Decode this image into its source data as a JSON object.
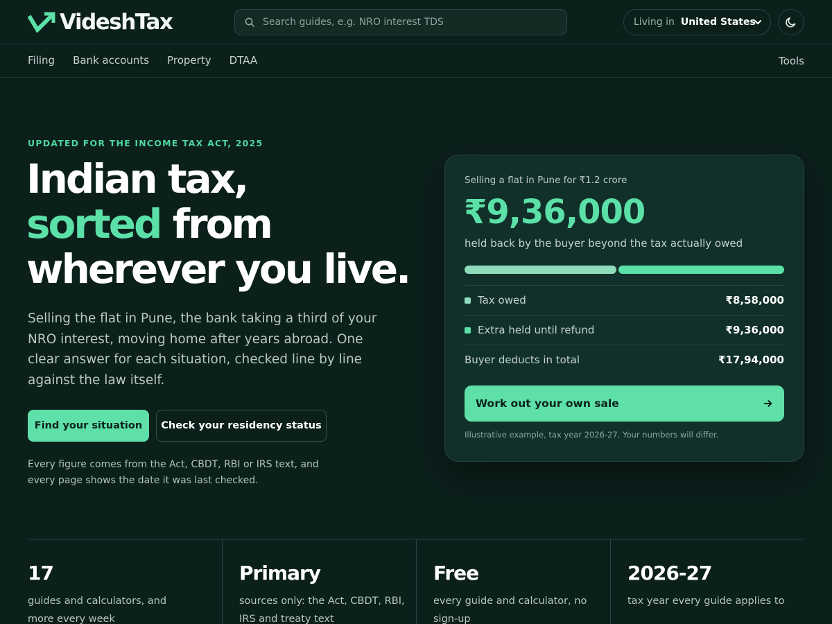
{
  "brand": {
    "name": "VideshTax",
    "accent": "#5be0a7",
    "background": "#0b1f1b"
  },
  "header": {
    "search": {
      "placeholder": "Search guides, e.g. NRO interest TDS",
      "value": "",
      "icon": "search-icon"
    },
    "region": {
      "label": "Living in",
      "selected": "United States",
      "icon": "chevron-down-icon"
    },
    "theme_toggle": {
      "icon": "moon-icon"
    }
  },
  "nav": {
    "items": [
      {
        "label": "Filing"
      },
      {
        "label": "Bank accounts"
      },
      {
        "label": "Property"
      },
      {
        "label": "DTAA"
      }
    ],
    "right_item": {
      "label": "Tools"
    }
  },
  "hero": {
    "eyebrow": "UPDATED FOR THE INCOME TAX ACT, 2025",
    "headline": {
      "line1": "Indian tax,",
      "accent": "sorted",
      "line2_rest": " from",
      "line3": "wherever you live."
    },
    "lede": "Selling the flat in Pune, the bank taking a third of your NRO interest, moving home after years abroad. One clear answer for each situation, checked line by line against the law itself.",
    "primary_cta": "Find your situation",
    "secondary_cta": "Check your residency status",
    "footnote": "Every figure comes from the Act, CBDT, RBI or IRS text, and every page shows the date it was last checked."
  },
  "example_card": {
    "subtitle": "Selling a flat in Pune for ₹1.2 crore",
    "amount": "₹9,36,000",
    "caption": "held back by the buyer beyond the tax actually owed",
    "breakdown": {
      "tax_owed_value": 858000,
      "extra_held_value": 936000,
      "colors": {
        "tax_owed": "#8fdcbd",
        "extra_held": "#5be0a7"
      }
    },
    "rows": [
      {
        "label": "Tax owed",
        "value": "₹8,58,000"
      },
      {
        "label": "Extra held until refund",
        "value": "₹9,36,000"
      },
      {
        "label": "Buyer deducts in total",
        "value": "₹17,94,000"
      }
    ],
    "cta": {
      "label": "Work out your own sale",
      "icon": "arrow-right-icon"
    },
    "note": "Illustrative example, tax year 2026-27. Your numbers will differ."
  },
  "stats": [
    {
      "value": "17",
      "desc": "guides and calculators, and more every week"
    },
    {
      "value": "Primary",
      "desc": "sources only: the Act, CBDT, RBI, IRS and treaty text"
    },
    {
      "value": "Free",
      "desc": "every guide and calculator, no sign-up"
    },
    {
      "value": "2026-27",
      "desc": "tax year every guide applies to"
    }
  ]
}
